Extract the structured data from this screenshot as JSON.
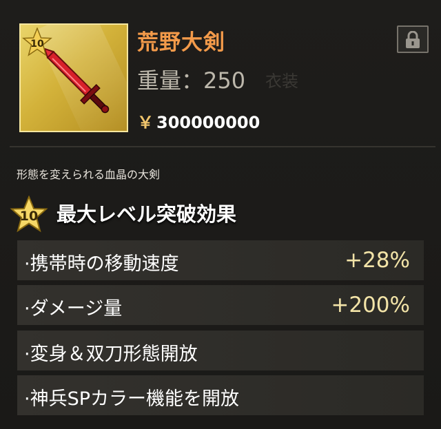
{
  "item": {
    "name": "荒野大剣",
    "level": "10",
    "weight_text": "重量：250",
    "bg_word": "衣装",
    "currency_symbol": "￥",
    "price": "300000000",
    "description": "形態を変えられる血晶の大剣"
  },
  "limit_break": {
    "level": "10",
    "title": "最大レベル突破効果",
    "effects": [
      {
        "label": "·携帯時の移動速度",
        "value": "+28%"
      },
      {
        "label": "·ダメージ量",
        "value": "+200%"
      },
      {
        "label": "·変身＆双刀形態開放",
        "value": ""
      },
      {
        "label": "·神兵SPカラー機能を開放",
        "value": ""
      }
    ]
  },
  "icons": {
    "lock": "lock-icon",
    "star": "star-icon",
    "sword": "sword-icon"
  },
  "colors": {
    "item_name": "#f39a4a",
    "value": "#f3e4a8",
    "price_symbol": "#f1c56c",
    "frame_gold": "#d3b23a"
  }
}
